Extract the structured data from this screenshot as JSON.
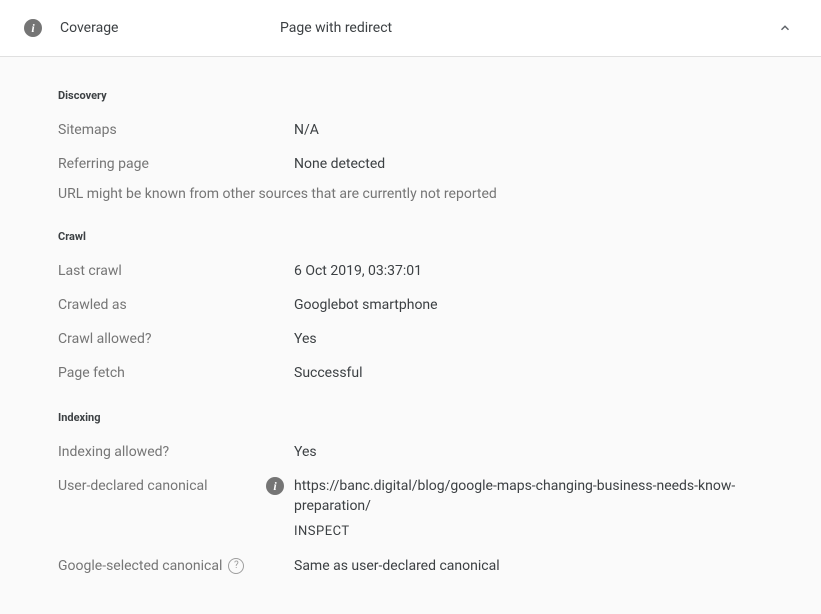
{
  "header": {
    "label": "Coverage",
    "value": "Page with redirect"
  },
  "discovery": {
    "title": "Discovery",
    "sitemaps": {
      "label": "Sitemaps",
      "value": "N/A"
    },
    "referring": {
      "label": "Referring page",
      "value": "None detected"
    },
    "note": "URL might be known from other sources that are currently not reported"
  },
  "crawl": {
    "title": "Crawl",
    "last_crawl": {
      "label": "Last crawl",
      "value": "6 Oct 2019, 03:37:01"
    },
    "crawled_as": {
      "label": "Crawled as",
      "value": "Googlebot smartphone"
    },
    "crawl_allowed": {
      "label": "Crawl allowed?",
      "value": "Yes"
    },
    "page_fetch": {
      "label": "Page fetch",
      "value": "Successful"
    }
  },
  "indexing": {
    "title": "Indexing",
    "indexing_allowed": {
      "label": "Indexing allowed?",
      "value": "Yes"
    },
    "user_canonical": {
      "label": "User-declared canonical",
      "value": "https://banc.digital/blog/google-maps-changing-business-needs-know-preparation/",
      "inspect": "INSPECT"
    },
    "google_canonical": {
      "label": "Google-selected canonical",
      "value": "Same as user-declared canonical"
    }
  }
}
